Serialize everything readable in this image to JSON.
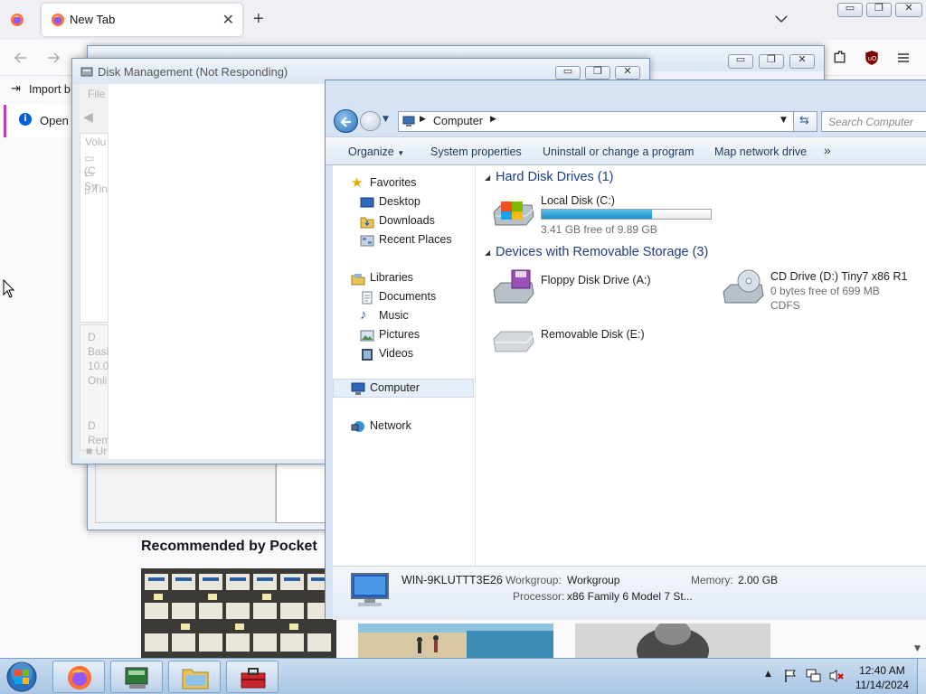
{
  "browser": {
    "tab_title": "New Tab",
    "bookmark_import": "Import b",
    "notification": "Open p",
    "pocket_heading": "Recommended by Pocket"
  },
  "disk_mgmt": {
    "title": "Disk Management (Not Responding)",
    "menu_file": "File",
    "col_volume": "Volu",
    "vol1": "(C",
    "vol2": "Sy",
    "vol3": "Tin",
    "disk_label_1": "D",
    "disk_type": "Basi",
    "disk_size": "10.0",
    "disk_status": "Onli",
    "disk_label_2": "D",
    "disk_rem": "Rem",
    "disk_un": "Ur"
  },
  "explorer": {
    "breadcrumb": "Computer",
    "search_placeholder": "Search Computer",
    "toolbar": {
      "organize": "Organize",
      "system_properties": "System properties",
      "uninstall": "Uninstall or change a program",
      "map_drive": "Map network drive",
      "more": "»"
    },
    "nav": {
      "favorites": "Favorites",
      "desktop": "Desktop",
      "downloads": "Downloads",
      "recent": "Recent Places",
      "libraries": "Libraries",
      "documents": "Documents",
      "music": "Music",
      "pictures": "Pictures",
      "videos": "Videos",
      "computer": "Computer",
      "network": "Network"
    },
    "groups": {
      "hdd": "Hard Disk Drives (1)",
      "removable": "Devices with Removable Storage (3)"
    },
    "drives": {
      "c_name": "Local Disk (C:)",
      "c_free": "3.41 GB free of 9.89 GB",
      "c_used_fraction": 0.655,
      "a_name": "Floppy Disk Drive (A:)",
      "d_name": "CD Drive (D:) Tiny7 x86 R1",
      "d_free": "0 bytes free of 699 MB",
      "d_fs": "CDFS",
      "e_name": "Removable Disk (E:)"
    },
    "details": {
      "computer_name": "WIN-9KLUTTT3E26",
      "workgroup_label": "Workgroup:",
      "workgroup": "Workgroup",
      "memory_label": "Memory:",
      "memory": "2.00 GB",
      "processor_label": "Processor:",
      "processor": "x86 Family 6 Model 7 St..."
    }
  },
  "taskbar": {
    "time": "12:40 AM",
    "date": "11/14/2024"
  },
  "colors": {
    "accent": "#1e3c87",
    "drive_bar": "#26a0da"
  }
}
